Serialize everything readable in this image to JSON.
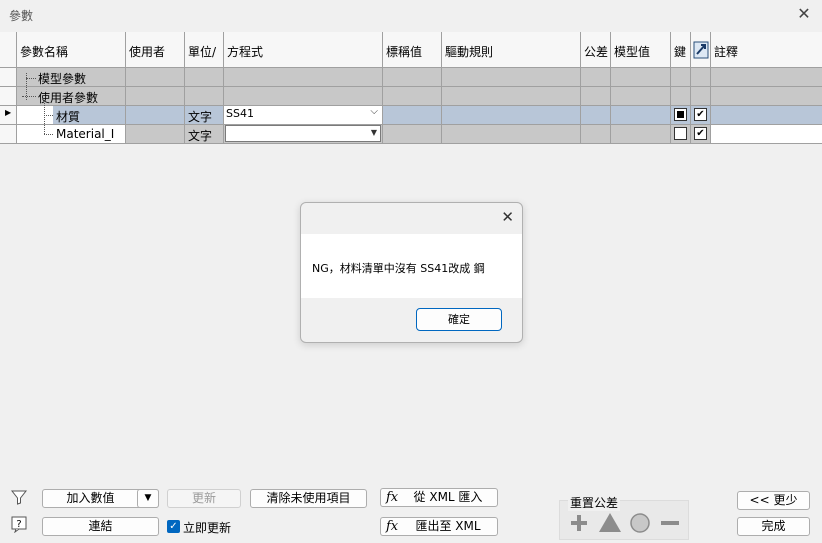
{
  "window": {
    "title": "參數",
    "close": "✕"
  },
  "columns": [
    "參數名稱",
    "使用者",
    "單位/",
    "方程式",
    "標稱值",
    "驅動規則",
    "公差",
    "模型值",
    "鍵",
    "",
    "註釋"
  ],
  "rows": {
    "model_params": "模型參數",
    "user_params": "使用者參數",
    "r1": {
      "name": "材質",
      "unit": "文字",
      "equation": "SS41"
    },
    "r2": {
      "name": "Material_I",
      "unit": "文字",
      "equation": ""
    }
  },
  "dialog": {
    "close": "✕",
    "message": "NG，材料清單中沒有 SS41改成 鋼",
    "ok": "確定"
  },
  "toolbar": {
    "add_value": "加入數值",
    "update": "更新",
    "clear_unused": "清除未使用項目",
    "import_xml": "從 XML 匯入",
    "link": "連結",
    "immediate_update": "立即更新",
    "export_xml": "匯出至 XML",
    "reset_tolerance": "重置公差",
    "less": "<< 更少",
    "done": "完成"
  }
}
